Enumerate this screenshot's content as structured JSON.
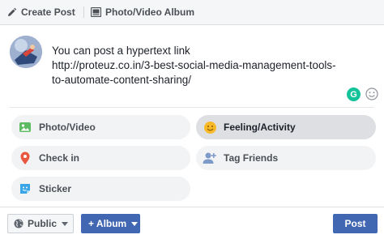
{
  "tabs": {
    "create_post": "Create Post",
    "photo_album": "Photo/Video Album"
  },
  "post": {
    "text": "You can post a hypertext link\nhttp://proteuz.co.in/3-best-social-media-management-tools-\nto-automate-content-sharing/"
  },
  "grammarly": {
    "label": "G"
  },
  "actions": [
    {
      "label": "Photo/Video",
      "icon": "photo-icon"
    },
    {
      "label": "Feeling/Activity",
      "icon": "smiley-icon"
    },
    {
      "label": "Check in",
      "icon": "location-pin-icon"
    },
    {
      "label": "Tag Friends",
      "icon": "tag-friends-icon"
    },
    {
      "label": "Sticker",
      "icon": "sticker-icon"
    }
  ],
  "footer": {
    "audience": "Public",
    "album": "+ Album",
    "post": "Post"
  },
  "colors": {
    "accent": "#4267b2",
    "photo_green": "#5dbb63",
    "feeling_yellow": "#f7b928",
    "checkin_red": "#e9573f",
    "tag_blue": "#7e9ac9",
    "sticker_blue": "#3aa5e6",
    "grammarly": "#15c39a"
  }
}
